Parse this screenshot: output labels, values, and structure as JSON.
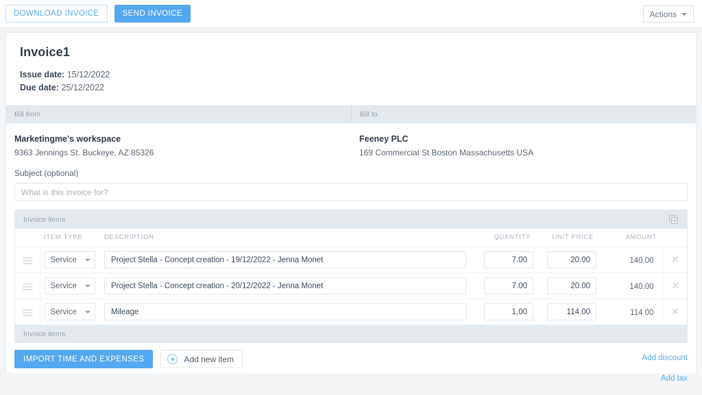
{
  "toolbar": {
    "download_label": "DOWNLOAD INVOICE",
    "send_label": "SEND INVOICE",
    "actions_label": "Actions",
    "caret_icon": "chevron-down-icon"
  },
  "invoice": {
    "title": "Invoice1",
    "issue_date_label": "Issue date:",
    "issue_date": "15/12/2022",
    "due_date_label": "Due date:",
    "due_date": "25/12/2022"
  },
  "bill": {
    "from_header": "Bill from",
    "to_header": "Bill to",
    "from_name": "Marketingme's workspace",
    "from_address": "9363 Jennings St. Buckeye, AZ 85326",
    "to_name": "Feeney PLC",
    "to_address": "169 Commercial St Boston Massachusetts USA"
  },
  "subject": {
    "label": "Subject (optional)",
    "placeholder": "What is this invoice for?",
    "value": ""
  },
  "items_panel": {
    "header_label": "Invoice items",
    "footer_label": "Invoice items",
    "duplicate_icon": "copy-icon",
    "columns": {
      "item_type": "ITEM TYPE",
      "description": "DESCRIPTION",
      "quantity": "QUANTITY",
      "unit_price": "UNIT PRICE",
      "amount": "AMOUNT"
    },
    "rows": [
      {
        "handle_icon": "drag-handle-icon",
        "item_type": "Service",
        "description": "Project Stella - Concept creation - 19/12/2022 - Jenna Monet",
        "quantity": "7.00",
        "unit_price": "20.00",
        "amount": "140.00",
        "remove_icon": "close-icon"
      },
      {
        "handle_icon": "drag-handle-icon",
        "item_type": "Service",
        "description": "Project Stella - Concept creation - 20/12/2022 - Jenna Monet",
        "quantity": "7.00",
        "unit_price": "20.00",
        "amount": "140.00",
        "remove_icon": "close-icon"
      },
      {
        "handle_icon": "drag-handle-icon",
        "item_type": "Service",
        "description": "Mileage",
        "quantity": "1.00",
        "unit_price": "114.00",
        "amount": "114.00",
        "remove_icon": "close-icon"
      }
    ]
  },
  "footer": {
    "import_label": "IMPORT TIME AND EXPENSES",
    "add_item_label": "Add new item",
    "add_item_icon": "plus-circle-icon",
    "add_discount_label": "Add discount",
    "add_tax_label": "Add tax"
  },
  "colors": {
    "accent_blue": "#54a8ef",
    "link_blue": "#5aa9ee",
    "band_grey": "#e4e9ed",
    "page_bg": "#f4f5f7"
  }
}
